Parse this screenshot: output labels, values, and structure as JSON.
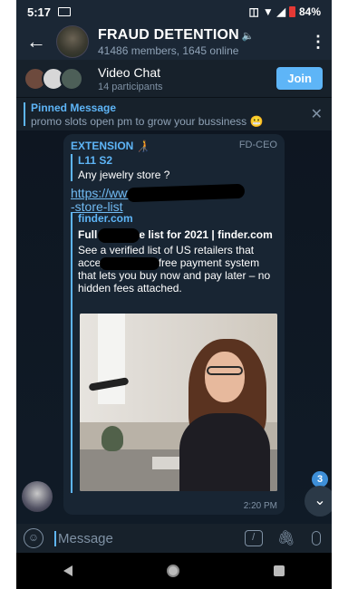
{
  "status_bar": {
    "time": "5:17",
    "battery": "84%"
  },
  "header": {
    "title": "FRAUD DETENTION",
    "subtitle": "41486 members, 1645 online"
  },
  "video_chat": {
    "title": "Video Chat",
    "participants": "14 participants",
    "join_label": "Join"
  },
  "pinned": {
    "title": "Pinned Message",
    "text": "promo slots open pm to grow your bussiness 😬"
  },
  "message": {
    "sender": "EXTENSION 🧑‍🦯",
    "badge": "FD-CEO",
    "reply_name": "L11 S2",
    "reply_text": "Any jewelry store ?",
    "link_line1": "https://www.",
    "link_line2": "-store-list",
    "preview_site": "finder.com",
    "preview_title": "Full          US store list for 2021 | finder.com",
    "preview_desc": "See a verified list of US retailers that accep                 n interest-free payment system that lets you buy now and pay later – no hidden fees attached.",
    "time": "2:20 PM"
  },
  "unread_count": "3",
  "composer": {
    "placeholder": "Message"
  },
  "colors": {
    "accent": "#5eb5f7",
    "background": "#0e1621",
    "bubble": "#182533"
  }
}
